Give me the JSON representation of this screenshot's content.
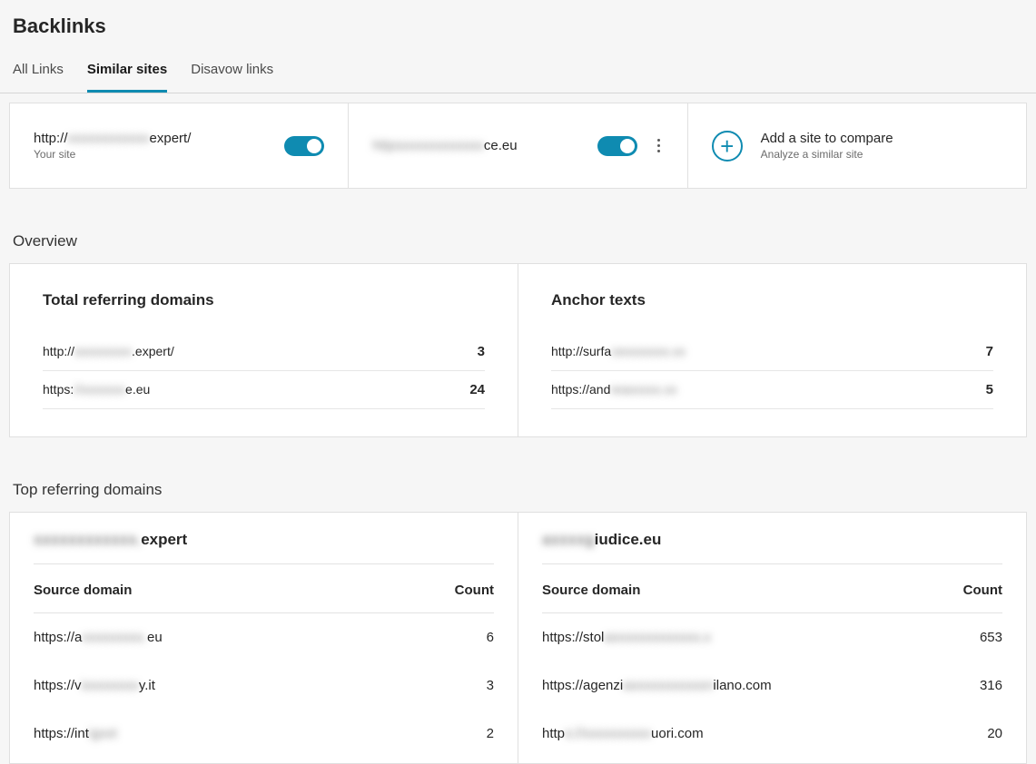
{
  "page_title": "Backlinks",
  "tabs": [
    {
      "label": "All Links",
      "active": false
    },
    {
      "label": "Similar sites",
      "active": true
    },
    {
      "label": "Disavow links",
      "active": false
    }
  ],
  "compare": {
    "your_site": {
      "url_prefix": "http://",
      "url_blur": "xxxxxxxxxxxx",
      "url_suffix": "expert/",
      "sub": "Your site"
    },
    "site2": {
      "url_blur": "httpsxxxxxxxxxxxx",
      "url_suffix": "ce.eu"
    },
    "add": {
      "title": "Add a site to compare",
      "sub": "Analyze a similar site"
    }
  },
  "overview": {
    "section_label": "Overview",
    "referring": {
      "title": "Total referring domains",
      "rows": [
        {
          "url_prefix": "http://",
          "url_blur": "sxxxxxxxx",
          "url_suffix": ".expert/",
          "value": "3"
        },
        {
          "url_prefix": "https:",
          "url_blur": "//xxxxxxx",
          "url_suffix": "e.eu",
          "value": "24"
        }
      ]
    },
    "anchor": {
      "title": "Anchor texts",
      "rows": [
        {
          "url_prefix": "http://surfa",
          "url_blur": "cexxxxxxx.xx",
          "url_suffix": "",
          "value": "7"
        },
        {
          "url_prefix": "https://and",
          "url_blur": "reaxxxxx.xx",
          "url_suffix": "",
          "value": "5"
        }
      ]
    }
  },
  "top_referring": {
    "section_label": "Top referring domains",
    "col_source": "Source domain",
    "col_count": "Count",
    "left": {
      "head_blur": "sxxxxxxxxxxx.",
      "head_suffix": "expert",
      "rows": [
        {
          "url_prefix": "https://a",
          "url_blur": "xxxxxxxxx.",
          "url_suffix": "eu",
          "count": "6"
        },
        {
          "url_prefix": "https://v",
          "url_blur": "ixxxxxxxx",
          "url_suffix": "y.it",
          "count": "3"
        },
        {
          "url_prefix": "https://int",
          "url_blur": "igxxt",
          "url_suffix": "",
          "count": "2"
        }
      ]
    },
    "right": {
      "head_blur": "axxxxg",
      "head_suffix": "iudice.eu",
      "rows": [
        {
          "url_prefix": "https://stol",
          "url_blur": "axxxxxxxxxxxxx.x",
          "url_suffix": "",
          "count": "653"
        },
        {
          "url_prefix": "https://agenzi",
          "url_blur": "axxxxxxxxxxxn",
          "url_suffix": "ilano.com",
          "count": "316"
        },
        {
          "url_prefix": "http",
          "url_blur": "s://xxxxxxxxxx",
          "url_suffix": "uori.com",
          "count": "20"
        }
      ]
    }
  }
}
